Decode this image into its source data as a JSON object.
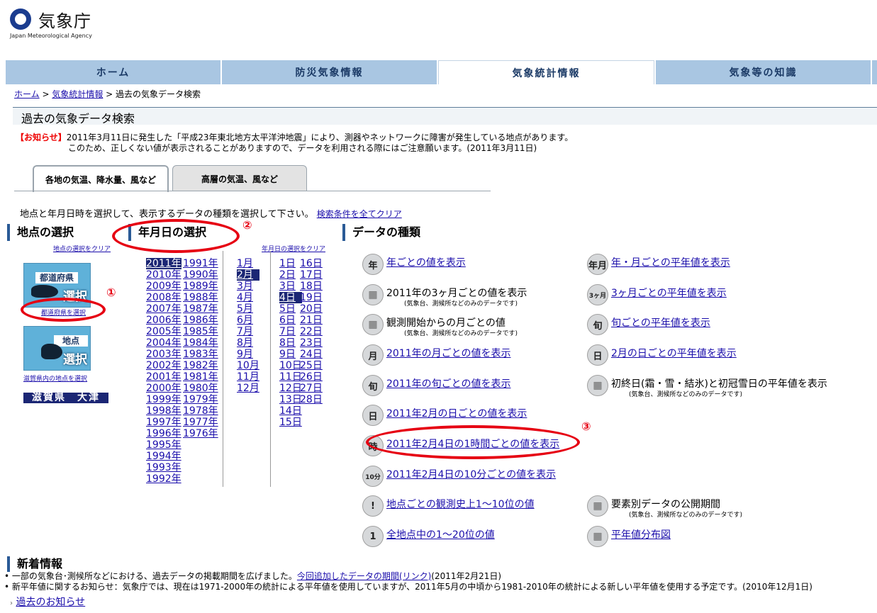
{
  "header": {
    "org_name": "気象庁",
    "org_name_en": "Japan Meteorological Agency"
  },
  "nav": [
    {
      "label": "ホーム",
      "active": false
    },
    {
      "label": "防災気象情報",
      "active": false
    },
    {
      "label": "気象統計情報",
      "active": true
    },
    {
      "label": "気象等の知識",
      "active": false
    }
  ],
  "breadcrumb": {
    "home": "ホーム",
    "sep1": " > ",
    "stats": "気象統計情報",
    "sep2": " > ",
    "current": "過去の気象データ検索"
  },
  "page_title": "過去の気象データ検索",
  "notice": {
    "label": "【お知らせ】",
    "line1": "2011年3月11日に発生した「平成23年東北地方太平洋沖地震」により、測器やネットワークに障害が発生している地点があります。",
    "line2": "このため、正しくない値が表示されることがありますので、データを利用される際にはご注意願います。(2011年3月11日)"
  },
  "tabs": {
    "surface": "各地の気温、降水量、風など",
    "upper": "高層の気温、風など"
  },
  "instruction": {
    "text": "地点と年月日時を選択して、表示するデータの種類を選択して下さい。",
    "clear_all": "検索条件を全てクリア"
  },
  "location": {
    "title": "地点の選択",
    "clear": "地点の選択をクリア",
    "pref_caption": "都道府県",
    "pref_select": "選択",
    "pref_link": "都道府県を選択",
    "station_caption": "地点",
    "station_select": "選択",
    "station_link": "滋賀県内の地点を選択",
    "selected_station": "滋賀県　大津"
  },
  "date": {
    "title": "年月日の選択",
    "clear": "年月日の選択をクリア",
    "years_col1": [
      "2011年",
      "2010年",
      "2009年",
      "2008年",
      "2007年",
      "2006年",
      "2005年",
      "2004年",
      "2003年",
      "2002年",
      "2001年",
      "2000年",
      "1999年",
      "1998年",
      "1997年",
      "1996年",
      "1995年",
      "1994年",
      "1993年",
      "1992年"
    ],
    "years_col2": [
      "1991年",
      "1990年",
      "1989年",
      "1988年",
      "1987年",
      "1986年",
      "1985年",
      "1984年",
      "1983年",
      "1982年",
      "1981年",
      "1980年",
      "1979年",
      "1978年",
      "1977年",
      "1976年"
    ],
    "selected_year": "2011年",
    "months": [
      "1月",
      "2月",
      "3月",
      "4月",
      "5月",
      "6月",
      "7月",
      "8月",
      "9月",
      "10月",
      "11月",
      "12月"
    ],
    "selected_month": "2月",
    "days_col1": [
      "1日",
      "2日",
      "3日",
      "4日",
      "5日",
      "6日",
      "7日",
      "8日",
      "9日",
      "10日",
      "11日",
      "12日",
      "13日",
      "14日",
      "15日"
    ],
    "days_col2": [
      "16日",
      "17日",
      "18日",
      "19日",
      "20日",
      "21日",
      "22日",
      "23日",
      "24日",
      "25日",
      "26日",
      "27日",
      "28日"
    ],
    "selected_day": "4日"
  },
  "datatype": {
    "title": "データの種類",
    "left": [
      {
        "icon": "年",
        "label": "年ごとの値を表示",
        "link": true,
        "note": ""
      },
      {
        "icon": "",
        "label": "2011年の3ヶ月ごとの値を表示",
        "link": false,
        "note": "(気象台、測候所などのみのデータです)"
      },
      {
        "icon": "",
        "label": "観測開始からの月ごとの値",
        "link": false,
        "note": "(気象台、測候所などのみのデータです)"
      },
      {
        "icon": "月",
        "label": "2011年の月ごとの値を表示",
        "link": true,
        "note": ""
      },
      {
        "icon": "旬",
        "label": "2011年の旬ごとの値を表示",
        "link": true,
        "note": ""
      },
      {
        "icon": "日",
        "label": "2011年2月の日ごとの値を表示",
        "link": true,
        "note": ""
      },
      {
        "icon": "時",
        "label": "2011年2月4日の1時間ごとの値を表示",
        "link": true,
        "note": ""
      },
      {
        "icon": "10分",
        "label": "2011年2月4日の10分ごとの値を表示",
        "link": true,
        "note": ""
      },
      {
        "icon": "!",
        "label": "地点ごとの観測史上1～10位の値",
        "link": true,
        "note": ""
      },
      {
        "icon": "1",
        "label": "全地点中の1～20位の値",
        "link": true,
        "note": ""
      }
    ],
    "right": [
      {
        "icon": "年月",
        "label": "年・月ごとの平年値を表示",
        "link": true,
        "note": ""
      },
      {
        "icon": "3ヶ月",
        "label": "3ヶ月ごとの平年値を表示",
        "link": true,
        "note": ""
      },
      {
        "icon": "旬",
        "label": "旬ごとの平年値を表示",
        "link": true,
        "note": ""
      },
      {
        "icon": "日",
        "label": "2月の日ごとの平年値を表示",
        "link": true,
        "note": ""
      },
      {
        "icon": "",
        "label": "初終日(霜・雪・結氷)と初冠雪日の平年値を表示",
        "link": false,
        "note": "(気象台、測候所などのみのデータです)"
      },
      {
        "icon": "",
        "label": "要素別データの公開期間",
        "link": false,
        "note": "(気象台、測候所などのみのデータです)"
      },
      {
        "icon": "",
        "label": "平年値分布図",
        "link": true,
        "note": ""
      }
    ]
  },
  "annotations": {
    "n1": "①",
    "n2": "②",
    "n3": "③"
  },
  "news": {
    "title": "新着情報",
    "item1_pre": "一部の気象台･測候所などにおける、過去データの掲載期間を広げました。",
    "item1_link": "今回追加したデータの期間(リンク)",
    "item1_post": "(2011年2月21日)",
    "item2": "新平年値に関するお知らせ：気象庁では、現在は1971-2000年の統計による平年値を使用していますが、2011年5月の中頃から1981-2010年の統計による新しい平年値を使用する予定です。(2010年12月1日)",
    "past": "過去のお知らせ"
  },
  "colors": {
    "nav_bg": "#a9c6e2",
    "selected_bg": "#1b2674",
    "annotation": "#e60012",
    "link": "#1a0dab"
  }
}
